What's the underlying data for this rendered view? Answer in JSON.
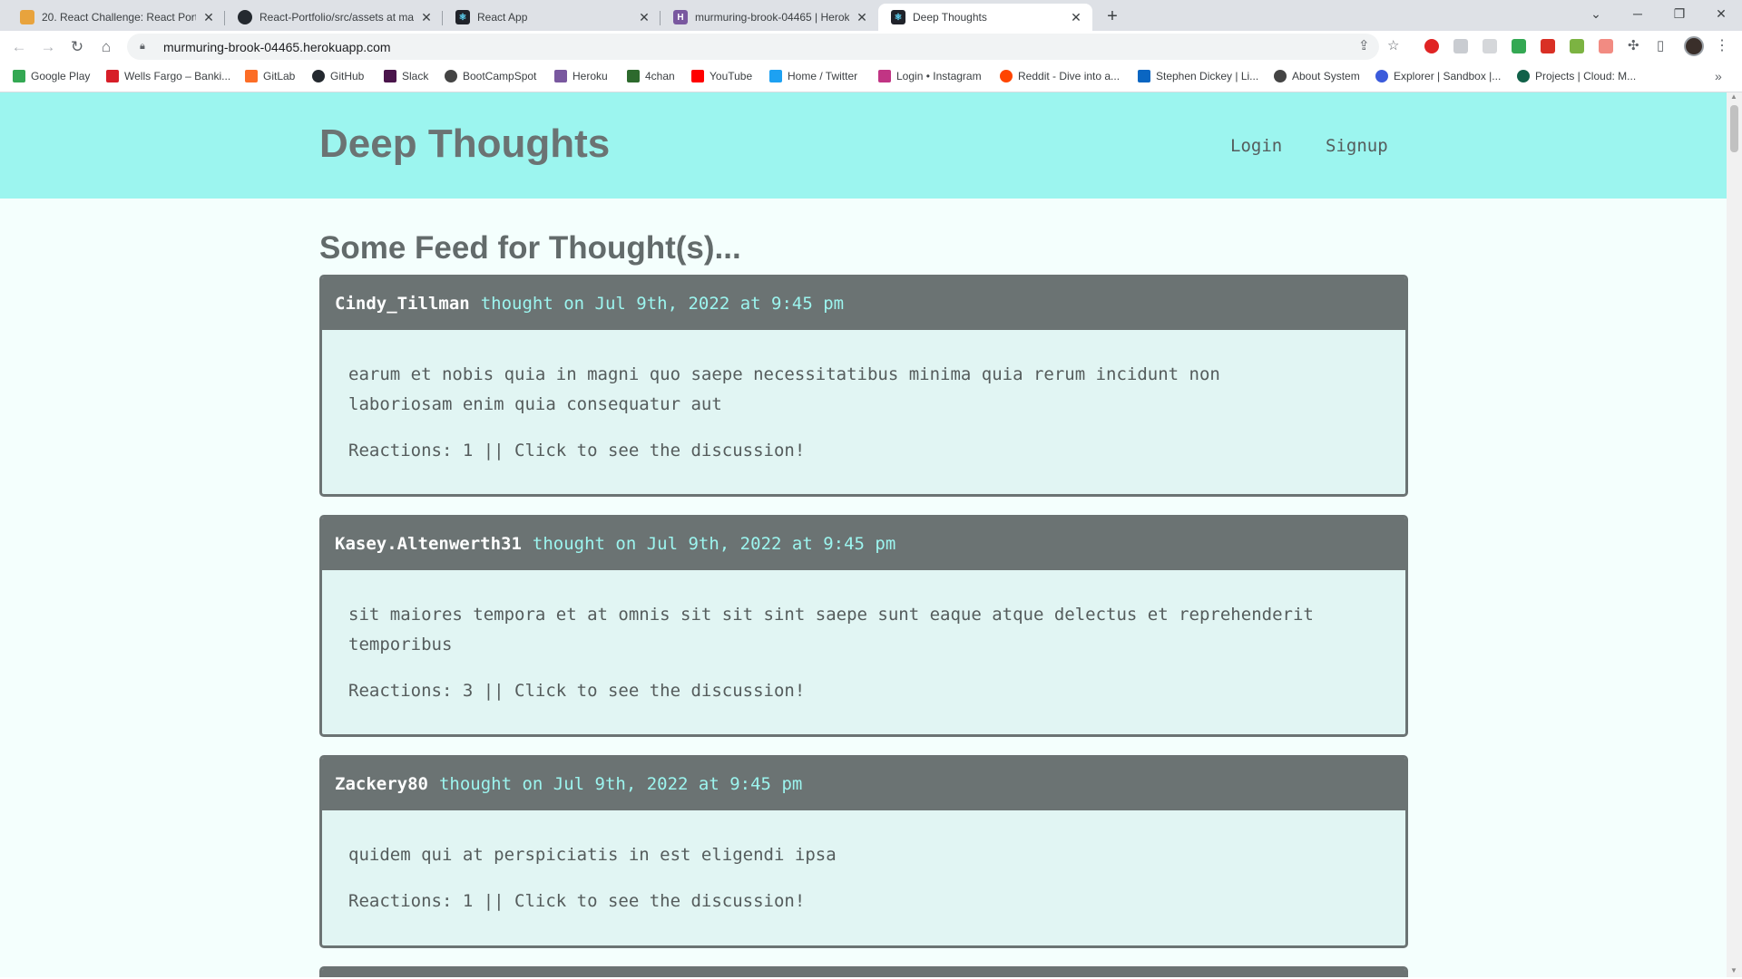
{
  "browser": {
    "tabs": [
      {
        "title": "20. React Challenge: React Portfolio",
        "icon": "lightbulb-favicon",
        "color": "#e8a33d"
      },
      {
        "title": "React-Portfolio/src/assets at main",
        "icon": "github-favicon",
        "color": "#24292f"
      },
      {
        "title": "React App",
        "icon": "react-favicon",
        "color": "#20232a"
      },
      {
        "title": "murmuring-brook-04465 | Heroku",
        "icon": "heroku-favicon",
        "color": "#79589f"
      },
      {
        "title": "Deep Thoughts",
        "icon": "react-favicon",
        "color": "#20232a"
      }
    ],
    "new_tab_label": "+",
    "url": "murmuring-brook-04465.herokuapp.com",
    "bookmarks": [
      {
        "label": "Google Play",
        "color": "#34a853"
      },
      {
        "label": "Wells Fargo – Banki...",
        "color": "#d71e28"
      },
      {
        "label": "GitLab",
        "color": "#fc6d26"
      },
      {
        "label": "GitHub",
        "color": "#24292f"
      },
      {
        "label": "Slack",
        "color": "#4a154b"
      },
      {
        "label": "BootCampSpot",
        "color": "#444444"
      },
      {
        "label": "Heroku",
        "color": "#79589f"
      },
      {
        "label": "4chan",
        "color": "#2d6a2d"
      },
      {
        "label": "YouTube",
        "color": "#ff0000"
      },
      {
        "label": "Home / Twitter",
        "color": "#1da1f2"
      },
      {
        "label": "Login • Instagram",
        "color": "#c13584"
      },
      {
        "label": "Reddit - Dive into a...",
        "color": "#ff4500"
      },
      {
        "label": "Stephen Dickey | Li...",
        "color": "#0a66c2"
      },
      {
        "label": "About System",
        "color": "#444444"
      },
      {
        "label": "Explorer | Sandbox |...",
        "color": "#3b5bdb"
      },
      {
        "label": "Projects | Cloud: M...",
        "color": "#116149"
      }
    ]
  },
  "site": {
    "brand": "Deep Thoughts",
    "nav": {
      "login": "Login",
      "signup": "Signup"
    },
    "feed_title": "Some Feed for Thought(s)...",
    "colors": {
      "header_bg": "#9cf5ef",
      "page_bg": "#f4fffd",
      "card_head": "#6b7373",
      "card_body": "#e1f5f3",
      "accent": "#9cf5ef"
    },
    "thoughts": [
      {
        "username": "Cindy_Tillman",
        "meta": "thought on Jul 9th, 2022 at 9:45 pm",
        "text_lines": [
          "earum et nobis quia in magni quo saepe necessitatibus minima quia rerum incidunt non",
          "laboriosam enim quia consequatur aut"
        ],
        "reactions": "Reactions: 1 || Click to see the discussion!"
      },
      {
        "username": "Kasey.Altenwerth31",
        "meta": "thought on Jul 9th, 2022 at 9:45 pm",
        "text_lines": [
          "sit maiores tempora et at omnis sit sit sint saepe sunt eaque atque delectus et reprehenderit",
          "temporibus"
        ],
        "reactions": "Reactions: 3 || Click to see the discussion!"
      },
      {
        "username": "Zackery80",
        "meta": "thought on Jul 9th, 2022 at 9:45 pm",
        "text_lines": [
          "quidem qui at perspiciatis in est eligendi ipsa"
        ],
        "reactions": "Reactions: 1 || Click to see the discussion!"
      }
    ]
  }
}
